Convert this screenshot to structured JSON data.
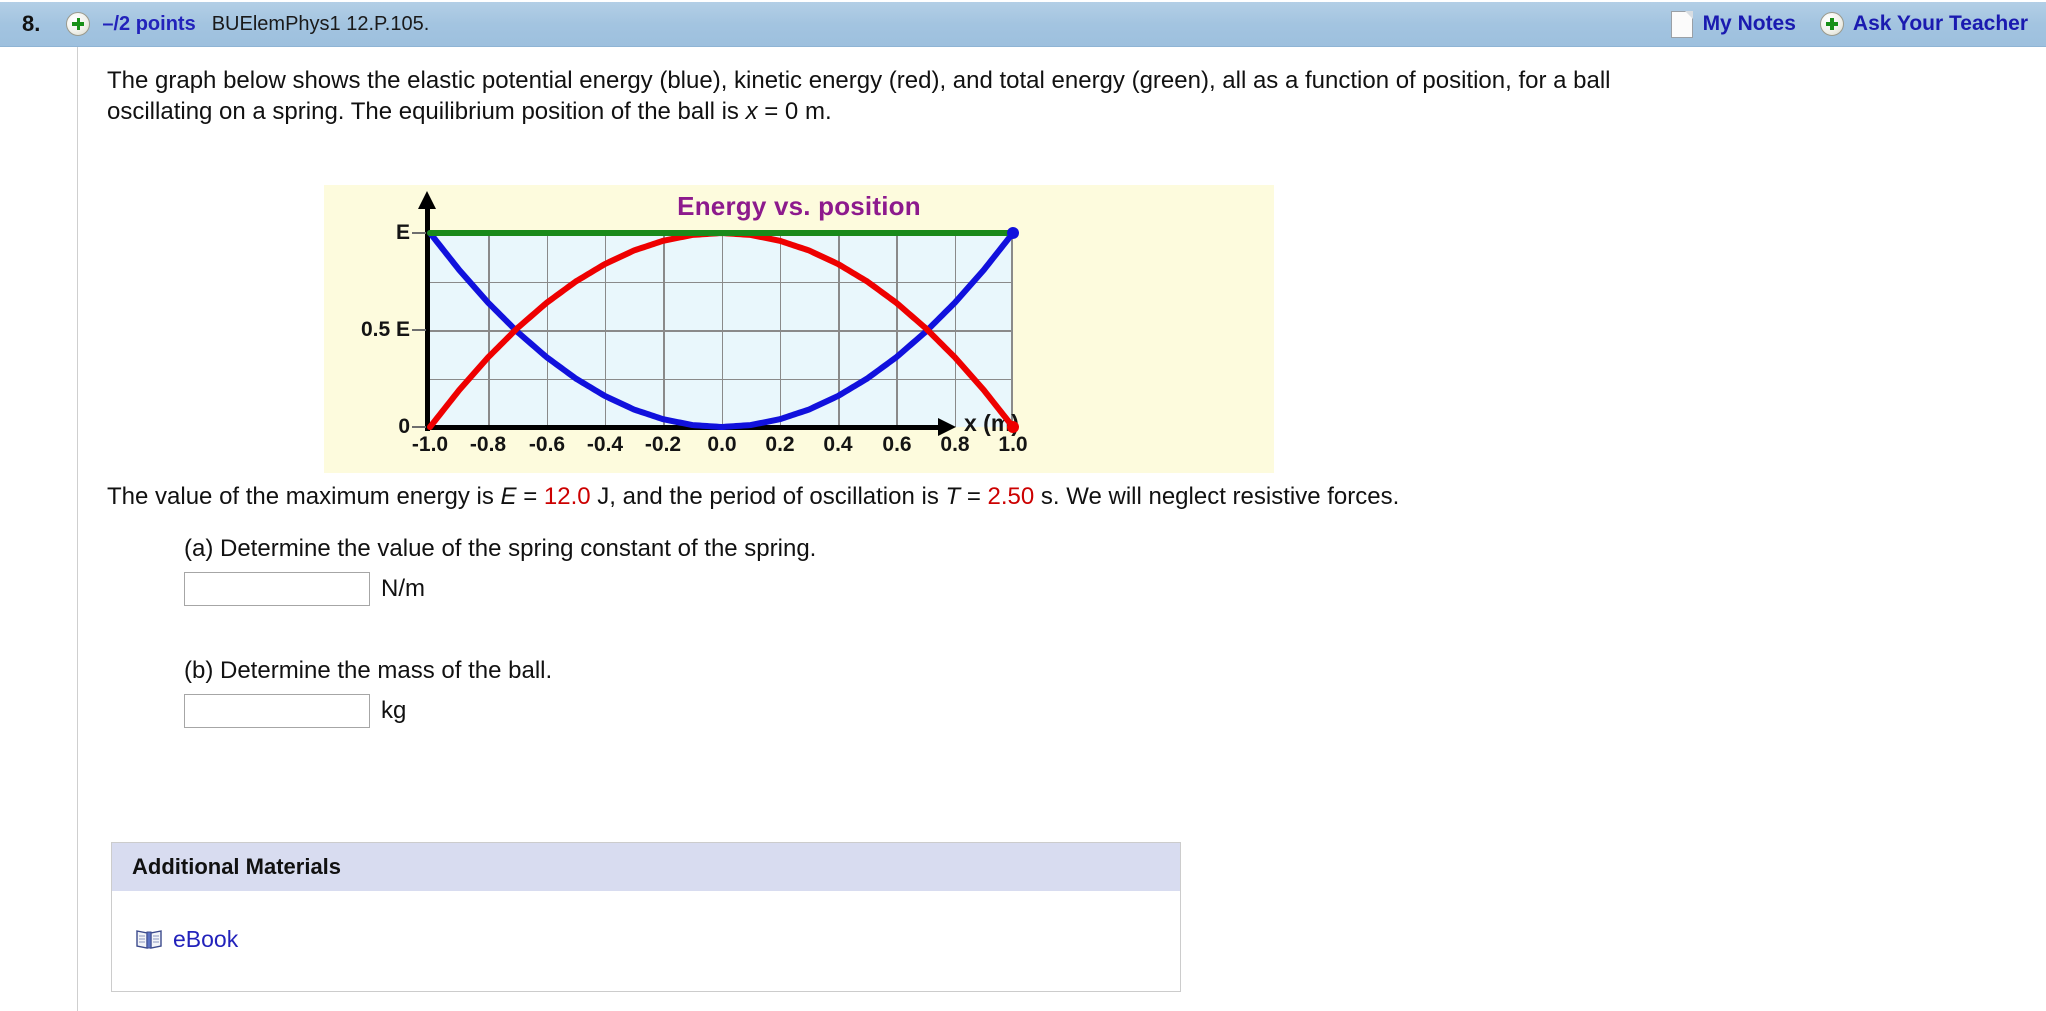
{
  "header": {
    "question_number": "8.",
    "plus_icon": "plus-circle-icon",
    "points": "–/2 points",
    "assignment_code": "BUElemPhys1 12.P.105.",
    "notes_icon": "note-page-icon",
    "my_notes_label": "My Notes",
    "ask_plus_icon": "plus-circle-icon",
    "ask_teacher_label": "Ask Your Teacher",
    "bar_color": "#a3c4e0",
    "link_color": "#1a1ab0"
  },
  "prompt": {
    "line1": "The graph below shows the elastic potential energy (blue), kinetic energy (red), and total energy (green), all as a function of position, for a ball",
    "line2_a": "oscillating on a spring. The equilibrium position of the ball is ",
    "line2_var": "x",
    "line2_b": " = 0 m."
  },
  "chart_data": {
    "type": "line",
    "title": "Energy vs. position",
    "xlabel": "x (m)",
    "ylabel": "",
    "xlim": [
      -1.0,
      1.0
    ],
    "ylim": [
      0,
      1.0
    ],
    "grid": true,
    "legend_position": "none",
    "panel_background": "#fdfbdd",
    "plot_background": "#e9f7fc",
    "xticks": [
      "-1.0",
      "-0.8",
      "-0.6",
      "-0.4",
      "-0.2",
      "0.0",
      "0.2",
      "0.4",
      "0.6",
      "0.8",
      "1.0"
    ],
    "xtick_values": [
      -1.0,
      -0.8,
      -0.6,
      -0.4,
      -0.2,
      0.0,
      0.2,
      0.4,
      0.6,
      0.8,
      1.0
    ],
    "yticks": [
      "0",
      "0.5 E",
      "E"
    ],
    "ytick_values": [
      0,
      0.5,
      1.0
    ],
    "series": [
      {
        "name": "elastic potential energy",
        "color": "#1111dd",
        "description": "U = E x^2, parabola opening upward, zero at x = 0, equals E at x = ±1.0",
        "x": [
          -1.0,
          -0.9,
          -0.8,
          -0.7,
          -0.6,
          -0.5,
          -0.4,
          -0.3,
          -0.2,
          -0.1,
          0.0,
          0.1,
          0.2,
          0.3,
          0.4,
          0.5,
          0.6,
          0.7,
          0.8,
          0.9,
          1.0
        ],
        "values": [
          1.0,
          0.81,
          0.64,
          0.49,
          0.36,
          0.25,
          0.16,
          0.09,
          0.04,
          0.01,
          0.0,
          0.01,
          0.04,
          0.09,
          0.16,
          0.25,
          0.36,
          0.49,
          0.64,
          0.81,
          1.0
        ]
      },
      {
        "name": "kinetic energy",
        "color": "#ee0000",
        "description": "K = E(1 - x^2), parabola opening downward, equals E at x = 0, zero at x = ±1.0",
        "x": [
          -1.0,
          -0.9,
          -0.8,
          -0.7,
          -0.6,
          -0.5,
          -0.4,
          -0.3,
          -0.2,
          -0.1,
          0.0,
          0.1,
          0.2,
          0.3,
          0.4,
          0.5,
          0.6,
          0.7,
          0.8,
          0.9,
          1.0
        ],
        "values": [
          0.0,
          0.19,
          0.36,
          0.51,
          0.64,
          0.75,
          0.84,
          0.91,
          0.96,
          0.99,
          1.0,
          0.99,
          0.96,
          0.91,
          0.84,
          0.75,
          0.64,
          0.51,
          0.36,
          0.19,
          0.0
        ]
      },
      {
        "name": "total energy",
        "color": "#1a8a1a",
        "description": "E_total = E, constant horizontal line at y = E",
        "x": [
          -1.0,
          1.0
        ],
        "values": [
          1.0,
          1.0
        ]
      }
    ],
    "markers": [
      {
        "series": "elastic potential energy",
        "x": 1.0,
        "y": 1.0,
        "color": "#1111dd"
      },
      {
        "series": "kinetic energy",
        "x": 1.0,
        "y": 0.0,
        "color": "#ee0000"
      }
    ]
  },
  "given": {
    "lead": "The value of the maximum energy is ",
    "E_symbol": "E",
    "E_eq": " = ",
    "E_value": "12.0",
    "E_unit": " J,",
    "mid": "  and the period of oscillation is ",
    "T_symbol": "T",
    "T_eq": " = ",
    "T_value": "2.50",
    "T_unit": " s.",
    "tail": "  We will neglect resistive forces."
  },
  "parts": [
    {
      "label": "(a) Determine the value of the spring constant of the spring.",
      "input_value": "",
      "input_placeholder": "",
      "unit": "N/m"
    },
    {
      "label": "(b) Determine the mass of the ball.",
      "input_value": "",
      "input_placeholder": "",
      "unit": "kg"
    }
  ],
  "additional_materials": {
    "header": "Additional Materials",
    "items": [
      {
        "icon": "open-book-icon",
        "label": "eBook"
      }
    ]
  }
}
